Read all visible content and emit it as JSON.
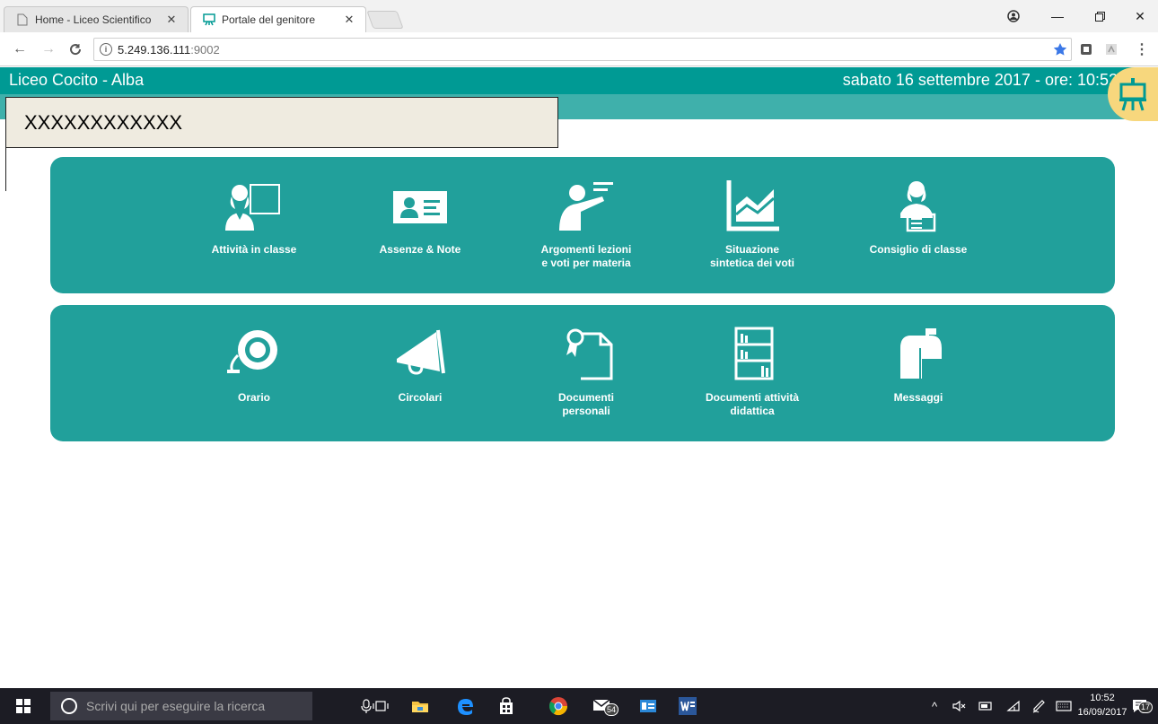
{
  "browser": {
    "tabs": [
      {
        "title": "Home - Liceo Scientifico",
        "active": false
      },
      {
        "title": "Portale del genitore",
        "active": true
      }
    ],
    "url_host": "5.249.136.111",
    "url_port": ":9002"
  },
  "header": {
    "school": "Liceo Cocito - Alba",
    "datetime": "sabato 16 settembre 2017 - ore: 10:52"
  },
  "user": {
    "name": "XXXXXXXXXXXX"
  },
  "tiles_row1": [
    {
      "label1": "Attività in classe",
      "label2": "",
      "icon": "teacher-board-icon"
    },
    {
      "label1": "Assenze & Note",
      "label2": "",
      "icon": "id-card-icon"
    },
    {
      "label1": "Argomenti lezioni",
      "label2": "e voti per materia",
      "icon": "teacher-pointing-icon"
    },
    {
      "label1": "Situazione",
      "label2": "sintetica dei voti",
      "icon": "chart-icon"
    },
    {
      "label1": "Consiglio di classe",
      "label2": "",
      "icon": "person-desk-icon"
    }
  ],
  "tiles_row2": [
    {
      "label1": "Orario",
      "label2": "",
      "icon": "bell-icon"
    },
    {
      "label1": "Circolari",
      "label2": "",
      "icon": "megaphone-icon"
    },
    {
      "label1": "Documenti",
      "label2": "personali",
      "icon": "certificate-document-icon"
    },
    {
      "label1": "Documenti attività",
      "label2": "didattica",
      "icon": "bookshelf-icon"
    },
    {
      "label1": "Messaggi",
      "label2": "",
      "icon": "mailbox-icon"
    }
  ],
  "taskbar": {
    "search_placeholder": "Scrivi qui per eseguire la ricerca",
    "mail_badge": "54",
    "time": "10:52",
    "date": "16/09/2017",
    "notif_badge": "17"
  },
  "colors": {
    "header": "#009a94",
    "subheader": "#3fb0ab",
    "panel": "#21a09b",
    "logo": "#f7d77d"
  }
}
